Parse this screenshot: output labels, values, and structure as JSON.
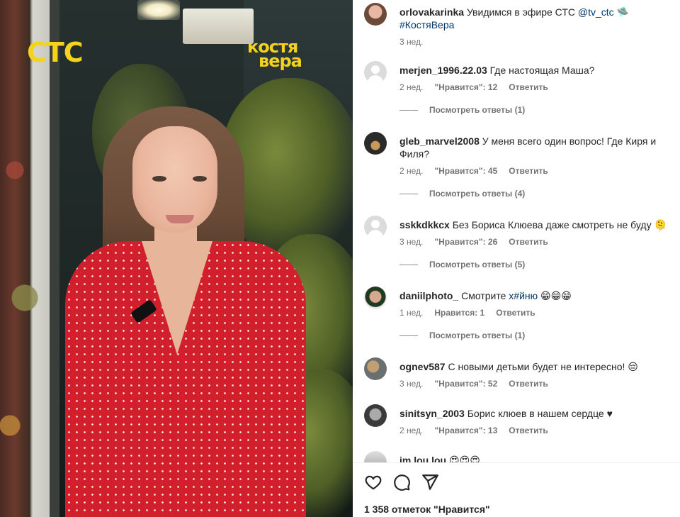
{
  "media": {
    "channel_logo": "СТС",
    "show_logo_line1": "костя",
    "show_logo_line2": "вера"
  },
  "caption": {
    "username": "orlovakarinka",
    "text": "Увидимся в эфире СТС",
    "mention": "@tv_ctc",
    "emoji": "🛸",
    "hashtag": "#КостяВера",
    "time": "3 нед."
  },
  "comments": [
    {
      "username": "merjen_1996.22.03",
      "text": "Где настоящая Маша?",
      "time": "2 нед.",
      "likes": "\"Нравится\": 12",
      "reply": "Ответить",
      "view_replies": "Посмотреть ответы (1)"
    },
    {
      "username": "gleb_marvel2008",
      "text": "У меня всего один вопрос! Где Киря и Филя?",
      "time": "2 нед.",
      "likes": "\"Нравится\": 45",
      "reply": "Ответить",
      "view_replies": "Посмотреть ответы (4)"
    },
    {
      "username": "sskkdkkcx",
      "text": "Без Бориса Клюева даже смотреть не буду 🫠",
      "time": "3 нед.",
      "likes": "\"Нравится\": 26",
      "reply": "Ответить",
      "view_replies": "Посмотреть ответы (5)"
    },
    {
      "username": "daniilphoto_",
      "text": "Смотрите",
      "link": "х#йню",
      "emoji": "😁😁😁",
      "time": "1 нед.",
      "likes": "Нравится: 1",
      "reply": "Ответить",
      "view_replies": "Посмотреть ответы (1)"
    },
    {
      "username": "ognev587",
      "text": "С новыми детьми будет не интересно! 😔",
      "time": "3 нед.",
      "likes": "\"Нравится\": 52",
      "reply": "Ответить"
    },
    {
      "username": "sinitsyn_2003",
      "text": "Борис клюев в нашем сердце ♥",
      "time": "2 нед.",
      "likes": "\"Нравится\": 13",
      "reply": "Ответить"
    },
    {
      "username": "im.lou.lou",
      "text": "😍😍😍"
    }
  ],
  "footer": {
    "likes_count": "1 358 отметок \"Нравится\""
  }
}
